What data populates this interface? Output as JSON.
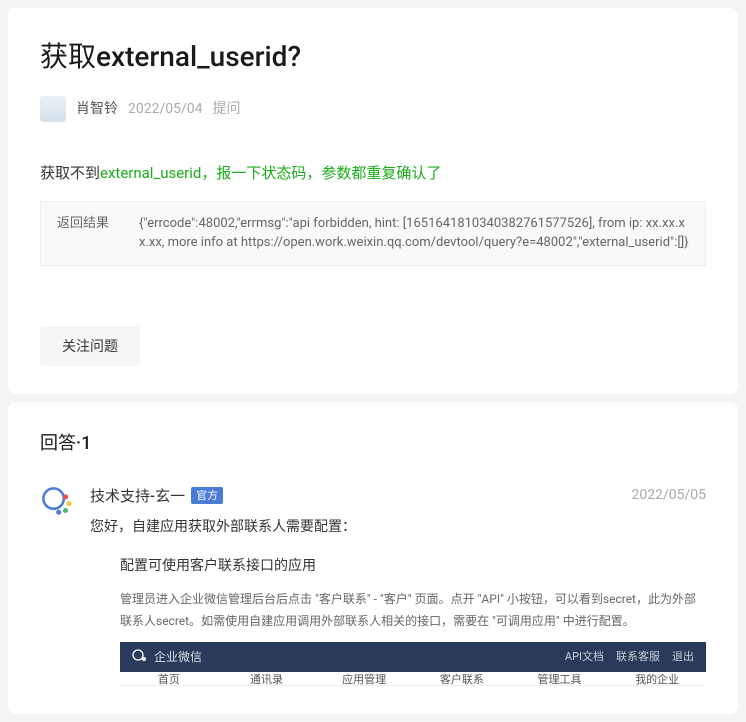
{
  "question": {
    "title": "获取external_userid?",
    "author": "肖智铃",
    "date": "2022/05/04",
    "ask_label": "提问",
    "content_prefix": "获取不到",
    "content_highlight": "external_userid，报一下状态码，参数都重复确认了",
    "result_label": "返回结果",
    "result_body": "{\"errcode\":48002,\"errmsg\":\"api forbidden, hint: [1651641810340382761577526], from ip: xx.xx.xx.xx, more info at https://open.work.weixin.qq.com/devtool/query?e=48002\",\"external_userid\":[]}",
    "follow_button": "关注问题"
  },
  "answers": {
    "header_prefix": "回答",
    "count": "·1",
    "items": [
      {
        "author": "技术支持-玄一",
        "badge": "官方",
        "date": "2022/05/05",
        "greeting": "您好，自建应用获取外部联系人需要配置：",
        "sub_heading": "配置可使用客户联系接口的应用",
        "sub_desc": "管理员进入企业微信管理后台后点击 \"客户联系\" - \"客户\" 页面。点开 \"API\" 小按钮，可以看到secret，此为外部联系人secret。如需使用自建应用调用外部联系人相关的接口，需要在 \"可调用应用\" 中进行配置。",
        "admin_bar": {
          "brand": "企业微信",
          "links": [
            "API文档",
            "联系客服",
            "退出"
          ]
        },
        "admin_nav": [
          "首页",
          "通讯录",
          "应用管理",
          "客户联系",
          "管理工具",
          "我的企业"
        ]
      }
    ]
  }
}
